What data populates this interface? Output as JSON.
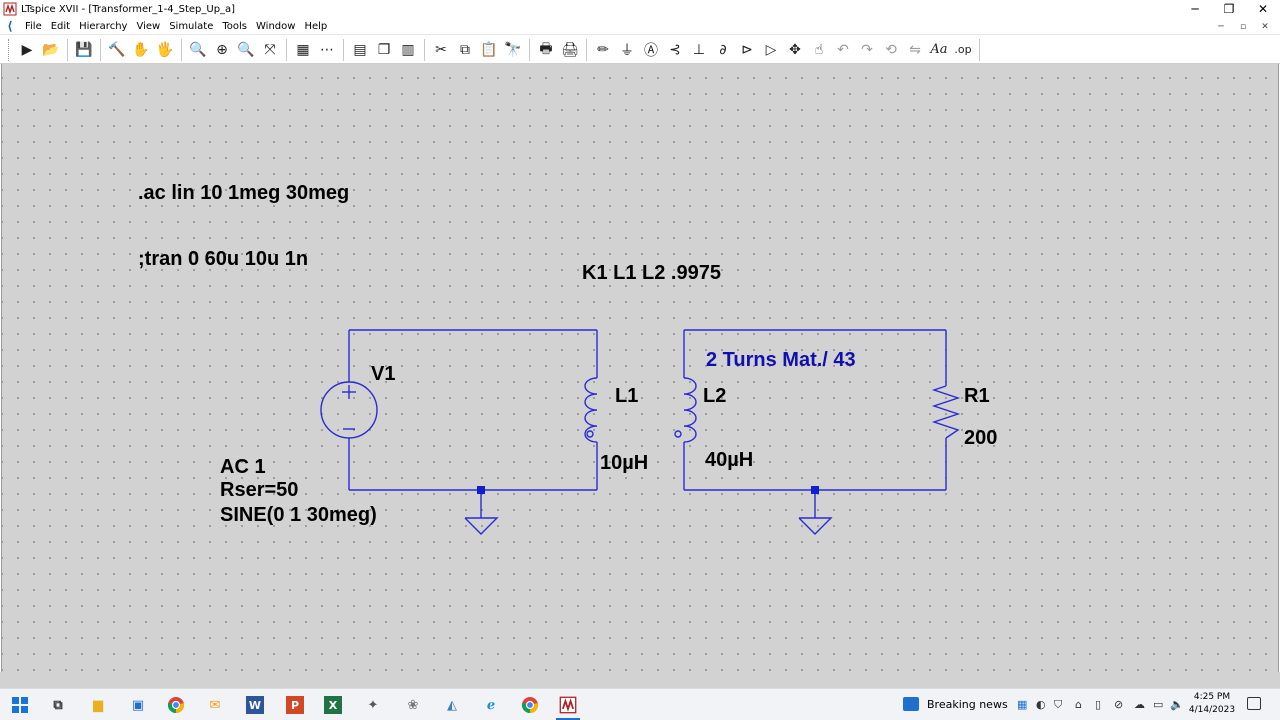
{
  "window": {
    "title": "LTspice XVII - [Transformer_1-4_Step_Up_a]",
    "controls": [
      "─",
      "❐",
      "✕"
    ],
    "mdi_controls": [
      "─",
      "▫",
      "✕"
    ]
  },
  "menu": [
    "File",
    "Edit",
    "Hierarchy",
    "View",
    "Simulate",
    "Tools",
    "Window",
    "Help"
  ],
  "toolbar": {
    "run": "▶",
    "open": "📂",
    "save": "💾",
    "control_panel": "🔨",
    "halt": "✋",
    "pan": "🖐",
    "zoom_in": "🔍",
    "zoom_area": "⊕",
    "zoom_out": "🔍",
    "zoom_fit": "⤧",
    "autorange": "▦",
    "grid": "⋯",
    "tile_h": "▤",
    "cascade": "❐",
    "tile_v": "▥",
    "cut": "✂",
    "copy": "⧉",
    "paste": "📋",
    "find": "🔭",
    "print_preview": "🖶",
    "print": "🖨",
    "wire": "✏",
    "ground": "⏚",
    "label": "Ⓐ",
    "resistor": "⊰",
    "capacitor": "⊥",
    "inductor": "∂",
    "diode": "⊳",
    "component": "▷",
    "move": "✥",
    "drag": "☝",
    "undo": "↶",
    "redo": "↷",
    "rotate": "⟲",
    "mirror": "⇋",
    "text": "Aa",
    "spice_directive": ".op"
  },
  "schematic": {
    "directive_ac": ".ac lin 10 1meg 30meg",
    "directive_tran": ";tran 0 60u 10u 1n",
    "coupling": "K1 L1 L2 .9975",
    "comment": "2 Turns Mat./ 43",
    "v1_name": "V1",
    "v1_ac": "AC 1",
    "v1_rser": "Rser=50",
    "v1_sine": "SINE(0 1 30meg)",
    "l1_name": "L1",
    "l1_value": "10µH",
    "l2_name": "L2",
    "l2_value": "40µH",
    "r1_name": "R1",
    "r1_value": "200",
    "colors": {
      "wire": "#2b2bd6",
      "node": "#1020d0",
      "symbol": "#2b2bd6",
      "background": "#d2d2d2",
      "comment": "#1010b0"
    }
  },
  "taskbar": {
    "news": "Breaking news",
    "clock_time": "4:25 PM",
    "clock_date": "4/14/2023",
    "apps": [
      "windows-start",
      "task-view",
      "file-explorer",
      "store",
      "chrome",
      "outlook",
      "word",
      "powerpoint",
      "excel",
      "app-8",
      "app-9",
      "app-10",
      "edge",
      "chrome-2",
      "ltspice"
    ]
  }
}
